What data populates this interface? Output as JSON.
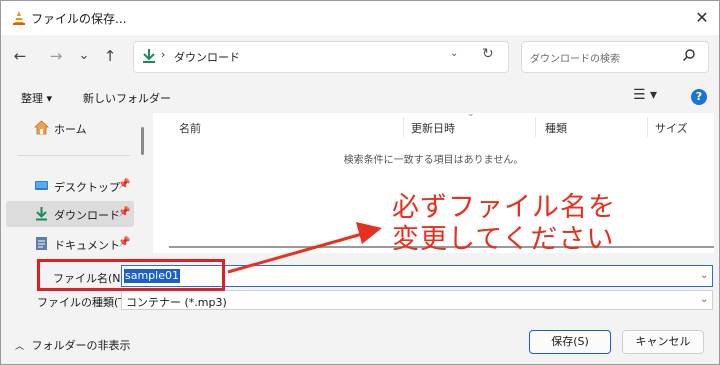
{
  "window": {
    "title": "ファイルの保存...",
    "icon": "vlc-cone-icon"
  },
  "nav": {
    "back": "←",
    "forward": "→",
    "recent": "⌄",
    "up": "↑"
  },
  "address": {
    "separator": "›",
    "path": "ダウンロード"
  },
  "search": {
    "placeholder": "ダウンロードの検索"
  },
  "toolbar": {
    "organize": "整理 ▾",
    "new_folder": "新しいフォルダー",
    "view": "☰ ▾",
    "help": "?"
  },
  "sidebar": {
    "items": [
      {
        "label": "ホーム"
      },
      {
        "label": "デスクトップ"
      },
      {
        "label": "ダウンロード",
        "selected": true
      },
      {
        "label": "ドキュメント"
      }
    ]
  },
  "columns": [
    "名前",
    "更新日時",
    "種類",
    "サイズ"
  ],
  "empty_message": "検索条件に一致する項目はありません。",
  "filename": {
    "label": "ファイル名(N):",
    "value": "sample01"
  },
  "filetype": {
    "label": "ファイルの種類(T):",
    "value": "コンテナー (*.mp3)"
  },
  "footer": {
    "hide_folders": "フォルダーの非表示",
    "save": "保存(S)",
    "cancel": "キャンセル"
  },
  "annotation": {
    "line1": "必ずファイル名を",
    "line2": "変更してください",
    "color": "#e83020"
  },
  "colors": {
    "accent": "#1a5fd0",
    "highlight_red": "#e02020"
  }
}
